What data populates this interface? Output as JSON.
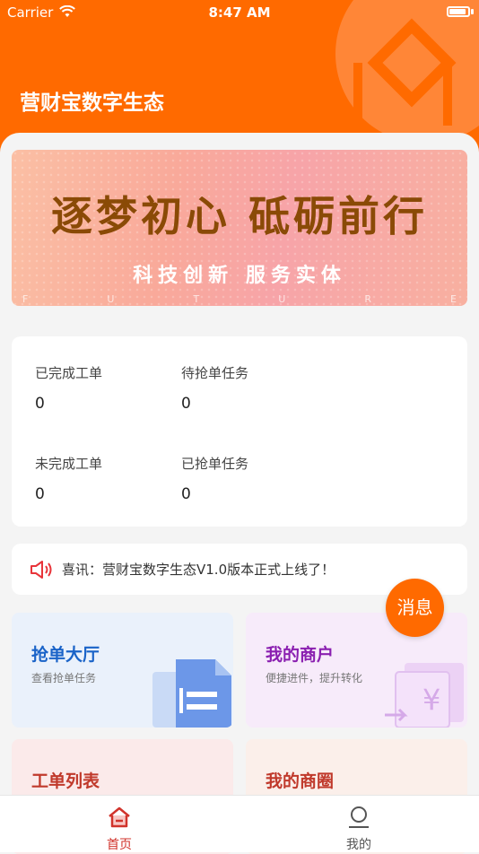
{
  "status": {
    "carrier": "Carrier",
    "time": "8:47 AM"
  },
  "header": {
    "title": "营财宝数字生态"
  },
  "banner": {
    "title": "逐梦初心 砥砺前行",
    "subtitle": "科技创新  服务实体",
    "future_letters": [
      "F",
      "U",
      "T",
      "U",
      "R",
      "E"
    ]
  },
  "stats": [
    {
      "label": "已完成工单",
      "value": "0"
    },
    {
      "label": "待抢单任务",
      "value": "0"
    },
    {
      "label": "未完成工单",
      "value": "0"
    },
    {
      "label": "已抢单任务",
      "value": "0"
    }
  ],
  "notice": {
    "text": "喜讯：营财宝数字生态V1.0版本正式上线了！"
  },
  "message_badge": "消息",
  "tiles": [
    {
      "title": "抢单大厅",
      "desc": "查看抢单任务",
      "color": "#1a63c8"
    },
    {
      "title": "我的商户",
      "desc": "便捷进件，提升转化",
      "color": "#8a1fb0"
    },
    {
      "title": "工单列表",
      "desc": "",
      "color": "#c0392b"
    },
    {
      "title": "我的商圈",
      "desc": "",
      "color": "#c0392b"
    }
  ],
  "tabbar": [
    {
      "label": "首页",
      "active": true,
      "icon": "home-icon"
    },
    {
      "label": "我的",
      "active": false,
      "icon": "profile-icon"
    }
  ],
  "colors": {
    "brand": "#ff6a00",
    "tab_active": "#d1332b",
    "tab_inactive": "#555555"
  }
}
